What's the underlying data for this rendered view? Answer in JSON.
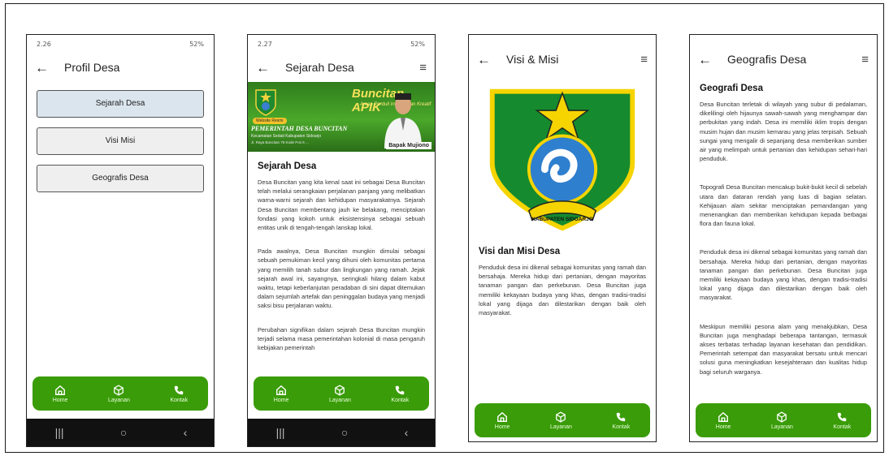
{
  "phone1": {
    "status_time": "2.26",
    "status_right": "52%",
    "title": "Profil Desa",
    "buttons": [
      "Sejarah Desa",
      "Visi Misi",
      "Geografis Desa"
    ]
  },
  "phone2": {
    "status_time": "2.27",
    "status_right": "52%",
    "title": "Sejarah Desa",
    "banner": {
      "headline": "Buncitan APIK",
      "tagline": "Aman Perduli Inovasi dan Kreatif",
      "badge": "Website Resmi",
      "org": "PEMERINTAH DESA BUNCITAN",
      "district": "Kecamatan Sedati Kabupaten Sidoarjo",
      "address": "Jl. Raya Buncitan 78 Kode Pos 6 ...",
      "person": "Bapak Mujiono"
    },
    "heading": "Sejarah Desa",
    "paragraphs": [
      "Desa Buncitan yang kita kenal saat ini sebagai Desa Buncitan telah melalui serangkaian perjalanan panjang yang melibatkan warna-warni sejarah dan kehidupan masyarakatnya. Sejarah Desa Buncitan membentang jauh ke belakang, menciptakan fondasi yang kokoh untuk eksistensinya sebagai sebuah entitas unik di tengah-tengah lanskap lokal.",
      "Pada awalnya, Desa Buncitan mungkin dimulai sebagai sebuah pemukiman kecil yang dihuni oleh komunitas pertama yang memilih tanah subur dan lingkungan yang ramah. Jejak sejarah awal ini, sayangnya, seringkali hilang dalam kabut waktu, tetapi keberlanjutan peradaban di sini dapat ditemukan dalam sejumlah artefak dan peninggalan budaya yang menjadi saksi bisu perjalanan waktu.",
      "Perubahan signifikan dalam sejarah Desa Buncitan mungkin terjadi selama masa pemerintahan kolonial di masa pengaruh kebijakan pemerintah"
    ]
  },
  "phone3": {
    "title": "Visi & Misi",
    "emblem_text": "KABUPATEN SIDOARJO",
    "heading": "Visi dan Misi Desa",
    "paragraph": "Penduduk desa ini dikenal sebagai komunitas yang ramah dan bersahaja. Mereka hidup dari pertanian, dengan mayoritas tanaman pangan dan perkebunan. Desa Buncitan juga memiliki kekayaan budaya yang khas, dengan tradisi-tradisi lokal yang dijaga dan dilestarikan dengan baik oleh masyarakat."
  },
  "phone4": {
    "title": "Geografis Desa",
    "heading": "Geografi Desa",
    "paragraphs": [
      "Desa Buncitan terletak di wilayah yang subur di pedalaman, dikelilingi oleh hijaunya sawah-sawah yang menghampar dan perbukitan yang indah. Desa ini memiliki iklim tropis dengan musim hujan dan musim kemarau yang jelas terpisah. Sebuah sungai yang mengalir di sepanjang desa memberikan sumber air yang melimpah untuk pertanian dan kehidupan sehari-hari penduduk.",
      "Topografi Desa Buncitan mencakup bukit-bukit kecil di sebelah utara dan dataran rendah yang luas di bagian selatan. Kehijauan alam sekitar menciptakan pemandangan yang menenangkan dan memberikan kehidupan kepada berbagai flora dan fauna lokal.",
      "Penduduk desa ini dikenal sebagai komunitas yang ramah dan bersahaja. Mereka hidup dari pertanian, dengan mayoritas tanaman pangan dan perkebunan. Desa Buncitan juga memiliki kekayaan budaya yang khas, dengan tradisi-tradisi lokal yang dijaga dan dilestarikan dengan baik oleh masyarakat.",
      "Meskipun memiliki pesona alam yang menakjubkan, Desa Buncitan juga menghadapi beberapa tantangan, termasuk akses terbatas terhadap layanan kesehatan dan pendidikan. Pemerintah setempat dan masyarakat bersatu untuk mencari solusi guna meningkatkan kesejahteraan dan kualitas hidup bagi seluruh warganya."
    ]
  },
  "nav": {
    "home": "Home",
    "layanan": "Layanan",
    "kontak": "Kontak"
  },
  "icons": {
    "back": "←",
    "menu": "≡",
    "recents": "|||",
    "homebtn": "○",
    "backbtn": "‹"
  },
  "colors": {
    "nav_green": "#3a9c08",
    "active_button": "#dbe5ee"
  }
}
